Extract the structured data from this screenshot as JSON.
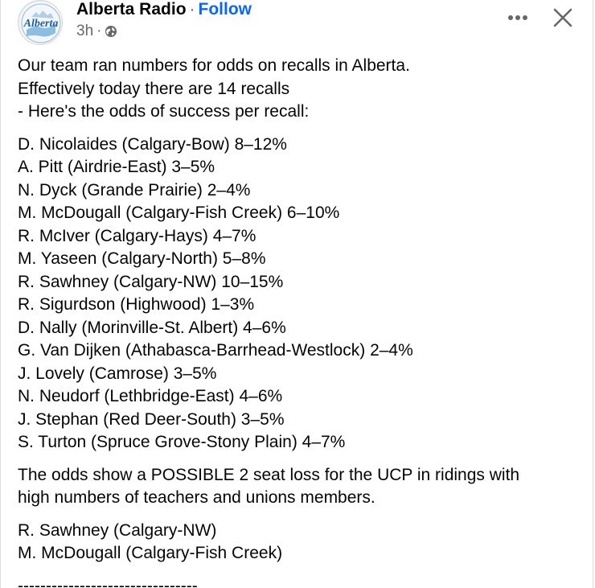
{
  "post": {
    "author": "Alberta Radio",
    "separator": "·",
    "follow_label": "Follow",
    "timestamp": "3h",
    "meta_separator": "·",
    "avatar_text": "Alberta",
    "audience_icon": "globe-icon",
    "more_icon": "more-options-icon",
    "close_icon": "close-icon",
    "intro": [
      "Our team ran numbers for odds on recalls in Alberta.",
      "Effectively today there are 14 recalls",
      "- Here's the odds of success per recall:"
    ],
    "recalls": [
      "D. Nicolaides (Calgary-Bow) 8–12%",
      "A. Pitt (Airdrie-East) 3–5%",
      "N. Dyck (Grande Prairie) 2–4%",
      "M. McDougall (Calgary-Fish Creek) 6–10%",
      "R. McIver (Calgary-Hays) 4–7%",
      "M. Yaseen (Calgary-North) 5–8%",
      "R. Sawhney (Calgary-NW) 10–15%",
      "R. Sigurdson (Highwood) 1–3%",
      "D. Nally (Morinville-St. Albert) 4–6%",
      "G. Van Dijken (Athabasca-Barrhead-Westlock) 2–4%",
      "J. Lovely (Camrose) 3–5%",
      "N. Neudorf (Lethbridge-East) 4–6%",
      "J. Stephan (Red Deer-South) 3–5%",
      "S. Turton (Spruce Grove-Stony Plain) 4–7%"
    ],
    "conclusion": [
      "The odds show a POSSIBLE 2 seat loss for the UCP in ridings with",
      "high numbers of teachers and unions members."
    ],
    "highlights": [
      "R. Sawhney (Calgary-NW)",
      "M. McDougall (Calgary-Fish Creek)"
    ],
    "divider": "--------------------------------"
  },
  "colors": {
    "follow": "#0866ff",
    "meta": "#65676b",
    "text": "#050505",
    "avatar_blue": "#2a6fb5"
  }
}
